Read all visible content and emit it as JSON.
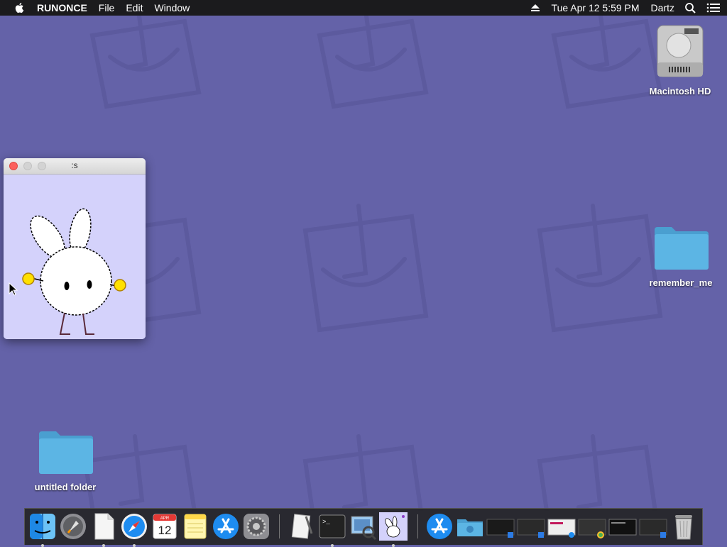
{
  "menubar": {
    "app_name": "RUNONCE",
    "menus": [
      "File",
      "Edit",
      "Window"
    ],
    "datetime": "Tue Apr 12  5:59 PM",
    "user": "Dartz"
  },
  "window": {
    "title": ":s",
    "background": "#d4d2fb"
  },
  "desktop_icons": {
    "hd": "Macintosh HD",
    "folder1": "remember_me",
    "folder2": "untitled folder"
  },
  "dock": {
    "calendar_month": "APR",
    "calendar_day": "12",
    "items": [
      "Finder",
      "Launchpad",
      "TextEdit",
      "Safari",
      "Calendar",
      "Notes",
      "App Store",
      "System Preferences",
      "Script Editor",
      "Terminal",
      "Preview",
      "RUNONCE",
      "App Store",
      "Downloads",
      "Trash"
    ]
  },
  "colors": {
    "wallpaper": "#6462a8",
    "menubar": "#1b1b1d",
    "folder": "#5cb5e4"
  }
}
